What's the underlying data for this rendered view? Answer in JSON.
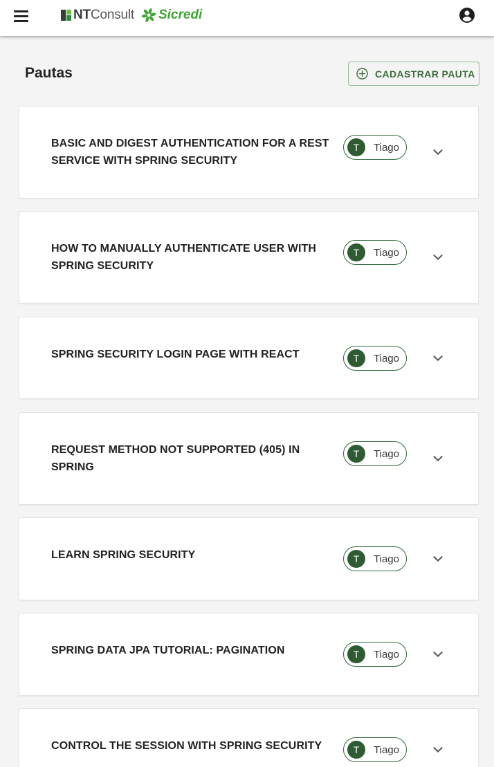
{
  "header": {
    "brand_nt_bold": "NT",
    "brand_nt_rest": "Consult",
    "brand_partner": "Sicredi"
  },
  "main": {
    "title": "Pautas",
    "add_button_label": "CADASTRAR PAUTA"
  },
  "pautas": [
    {
      "title": "BASIC AND DIGEST AUTHENTICATION FOR A REST SERVICE WITH SPRING SECURITY",
      "author_initial": "T",
      "author": "Tiago"
    },
    {
      "title": "HOW TO MANUALLY AUTHENTICATE USER WITH SPRING SECURITY",
      "author_initial": "T",
      "author": "Tiago"
    },
    {
      "title": "SPRING SECURITY LOGIN PAGE WITH REACT",
      "author_initial": "T",
      "author": "Tiago"
    },
    {
      "title": "REQUEST METHOD NOT SUPPORTED (405) IN SPRING",
      "author_initial": "T",
      "author": "Tiago"
    },
    {
      "title": "LEARN SPRING SECURITY",
      "author_initial": "T",
      "author": "Tiago"
    },
    {
      "title": "SPRING DATA JPA TUTORIAL: PAGINATION",
      "author_initial": "T",
      "author": "Tiago"
    },
    {
      "title": "CONTROL THE SESSION WITH SPRING SECURITY",
      "author_initial": "T",
      "author": "Tiago"
    }
  ],
  "icons": {
    "menu": "menu-icon",
    "account": "account-circle-icon",
    "add": "add-circle-outline-icon",
    "expand": "chevron-down-icon"
  },
  "colors": {
    "brand_green": "#3fa535",
    "chip_border": "#2f6b3b",
    "avatar_bg": "#2e5b31",
    "button_text": "#3d6b3d",
    "page_bg": "#f4f4f4"
  }
}
